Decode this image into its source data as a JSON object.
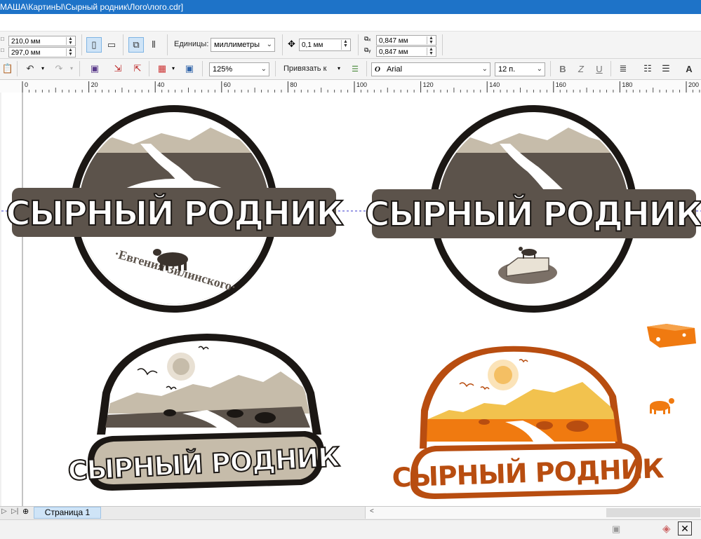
{
  "titlebar": {
    "path": "МАША\\КартинЫ\\Сырный родник\\Лого\\лого.cdr]"
  },
  "propbar": {
    "width": "210,0 мм",
    "height": "297,0 мм",
    "units_label": "Единицы:",
    "units_value": "миллиметры",
    "nudge": "0,1 мм",
    "dup_x": "0,847 мм",
    "dup_y": "0,847 мм"
  },
  "stdbar": {
    "zoom": "125%",
    "snap_label": "Привязать к",
    "font_name": "Arial",
    "font_size": "12 п.",
    "bold": "B",
    "italic": "Z",
    "underline": "U",
    "textA": "A"
  },
  "ruler": {
    "ticks": [
      "0",
      "20",
      "40",
      "60",
      "80",
      "100",
      "120",
      "140",
      "160",
      "180",
      "200"
    ]
  },
  "logos": {
    "title": "СЫРНЫЙ РОДНИК",
    "subtitle": "·Евгения Зилинского·"
  },
  "tabs": {
    "page1": "Страница 1"
  },
  "colors": {
    "brown": "#5c534b",
    "dark": "#1b1714",
    "beige": "#c6bcaa",
    "orange": "#b84d10",
    "yellow": "#f2c24e",
    "sun": "#f4bf63"
  }
}
